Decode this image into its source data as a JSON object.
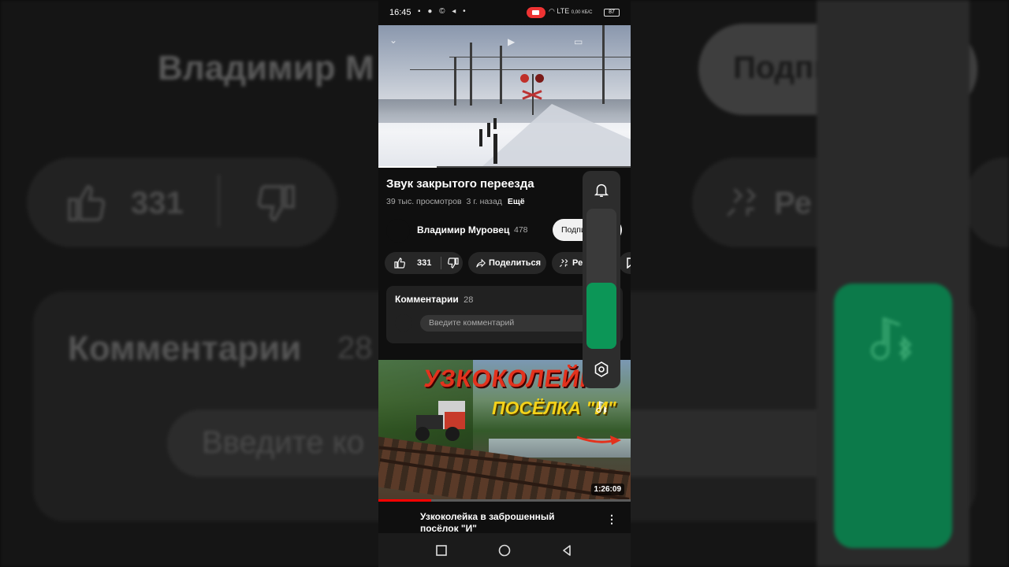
{
  "status_bar": {
    "time": "16:45",
    "left_icons": "▪ ● © ◂ •",
    "network": "LTE",
    "speed": "0,00 КБ/С",
    "battery": "87"
  },
  "video": {
    "title": "Звук закрытого переезда",
    "views": "39 тыс. просмотров",
    "age": "3 г. назад",
    "more_label": "Ещё",
    "progress_fraction": 0.23
  },
  "channel": {
    "name": "Владимир Муровец",
    "subscribers": "478",
    "subscribe_label": "Подписаться"
  },
  "actions": {
    "like_count": "331",
    "share_label": "Поделиться",
    "remix_label": "Ремикс"
  },
  "comments": {
    "title": "Комментарии",
    "count": "28",
    "placeholder": "Введите комментарий"
  },
  "next_video": {
    "thumb_title_line1": "УЗКОКОЛЕЙКА",
    "thumb_title_line2": "ПОСЁЛКА \"И\"",
    "duration": "1:26:09",
    "title": "Узкоколейка в заброшенный посёлок \"И\"",
    "title_line1": "Узкоколейка в заброшенный",
    "title_line2": "посёлок \"И\"",
    "watched_fraction": 0.21
  },
  "volume_overlay": {
    "level_fraction": 0.47,
    "accent_color": "#0c9657",
    "icons": [
      "bell-icon",
      "bluetooth-audio-icon",
      "settings-icon"
    ]
  },
  "background": {
    "title": "Владимир М",
    "subscribe": "Подпи",
    "like_count": "331",
    "remix": "Ре",
    "comments_title": "Комментарии",
    "comments_count": "28",
    "input": "Введите ко"
  }
}
